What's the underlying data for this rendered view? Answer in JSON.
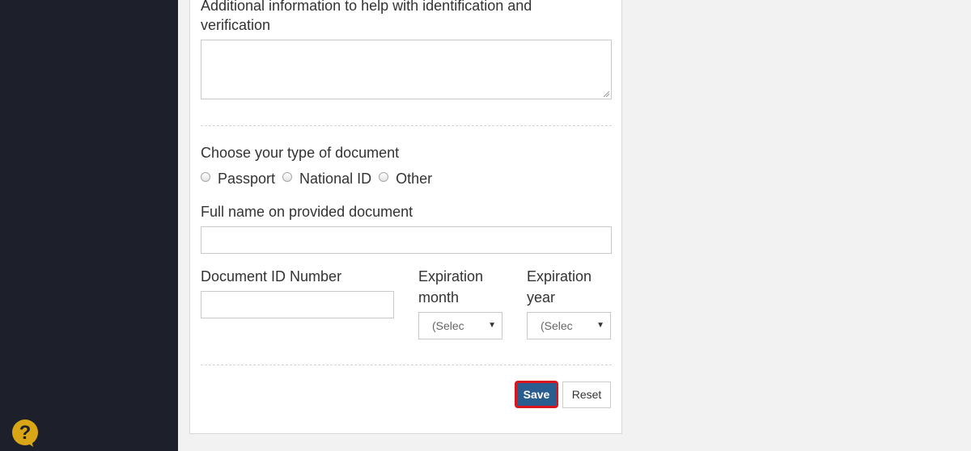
{
  "form": {
    "additional_info_label_line1": "Additional information to help with identification and",
    "additional_info_label_line2": "verification",
    "additional_info_value": "",
    "doc_type_label": "Choose your type of document",
    "doc_types": [
      "Passport",
      "National ID",
      "Other"
    ],
    "full_name_label": "Full name on provided document",
    "full_name_value": "",
    "doc_id_label": "Document ID Number",
    "doc_id_value": "",
    "exp_month_label_line1": "Expiration",
    "exp_month_label_line2": "month",
    "exp_month_selected": "(Selec",
    "exp_year_label_line1": "Expiration",
    "exp_year_label_line2": "year",
    "exp_year_selected": "(Selec",
    "save_label": "Save",
    "reset_label": "Reset"
  },
  "icons": {
    "help": "question-mark-help-icon",
    "dropdown": "caret-down-icon"
  },
  "colors": {
    "sidebar": "#1d202a",
    "save_button": "#2a5d8f",
    "save_focus_outline": "#d9151e",
    "help_icon": "#d9a615"
  }
}
